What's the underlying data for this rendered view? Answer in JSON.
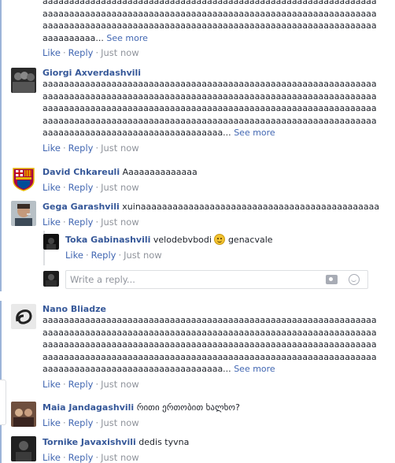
{
  "actions": {
    "like": "Like",
    "reply": "Reply",
    "time": "Just now",
    "sep": "·"
  },
  "see_more": "See more",
  "reply_placeholder": "Write a reply...",
  "comments": [
    {
      "name": "",
      "text": "aaaaaaaaaaaaaaaaaaaaaaaaaaaaaaaaaaaaaaaaaaaaaaaaaaaaaaaaaaaaaaaaaaaaaaaaaaaaaaaaaaaaaaaaaaaaaaaaaaaaaaaaaaaaaaaaaaaaaaaaaaaaaaaaaaaaaaaaaaaaaaaaaaaaaaaaaaaaaaaaaaaaaaaaaaaaaaaaaaaaaaaaaaaaaaaaaaaaaaa..."
    },
    {
      "name": "Giorgi Axverdashvili",
      "text": "aaaaaaaaaaaaaaaaaaaaaaaaaaaaaaaaaaaaaaaaaaaaaaaaaaaaaaaaaaaaaaaaaaaaaaaaaaaaaaaaaaaaaaaaaaaaaaaaaaaaaaaaaaaaaaaaaaaaaaaaaaaaaaaaaaaaaaaaaaaaaaaaaaaaaaaaaaaaaaaaaaaaaaaaaaaaaaaaaaaaaaaaaaaaaaaaaaaaaaaaaaaaaaaaaaaaaaaaaaaaaaaaaaaaaaaaaaaaaaaaaaaaaaaaaaaaaaaaaaaaaaaaaaaaaaaaaaaaaaaaaaaaaa..."
    },
    {
      "name": "David Chkareuli",
      "text": "Aaaaaaaaaaaaaa"
    },
    {
      "name": "Gega Garashvili",
      "text": "xuinaaaaaaaaaaaaaaaaaaaaaaaaaaaaaaaaaaaaaaaaaaaaa"
    },
    {
      "name": "Toka Gabinashvili",
      "text_before": "velodebvbodi",
      "text_after": "genacvale"
    },
    {
      "name": "Nano Bliadze",
      "text": "aaaaaaaaaaaaaaaaaaaaaaaaaaaaaaaaaaaaaaaaaaaaaaaaaaaaaaaaaaaaaaaaaaaaaaaaaaaaaaaaaaaaaaaaaaaaaaaaaaaaaaaaaaaaaaaaaaaaaaaaaaaaaaaaaaaaaaaaaaaaaaaaaaaaaaaaaaaaaaaaaaaaaaaaaaaaaaaaaaaaaaaaaaaaaaaaaaaaaaaaaaaaaaaaaaaaaaaaaaaaaaaaaaaaaaaaaaaaaaaaaaaaaaaaaaaaaaaaaaaaaaaaaaaaaaaaaaaaaaaaaaaaaa..."
    },
    {
      "name": "Maia Jandagashvili",
      "text": "რითი ერთობით ხალხო?"
    },
    {
      "name": "Tornike Javaxishvili",
      "text": "dedis tyvna"
    }
  ]
}
